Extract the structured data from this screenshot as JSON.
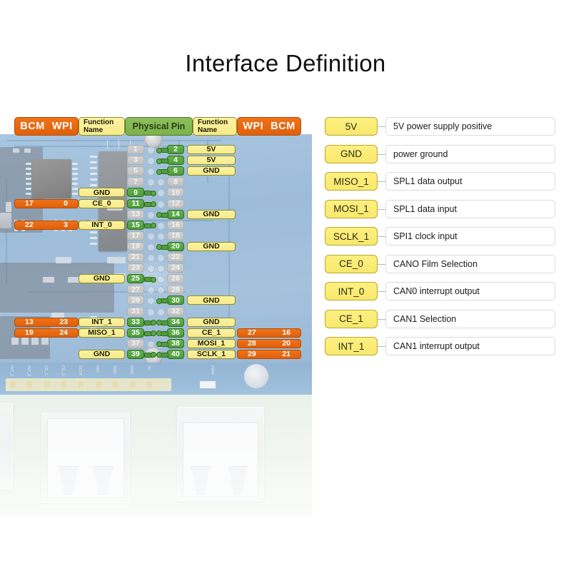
{
  "title": "Interface Definition",
  "header": {
    "left_bcm_wpi": [
      "BCM",
      "WPI"
    ],
    "left_function_name": [
      "Function",
      "Name"
    ],
    "physical_pin": "Physical Pin",
    "right_function_name": [
      "Function",
      "Name"
    ],
    "right_wpi_bcm": [
      "WPI",
      "BCM"
    ]
  },
  "pin_rows": [
    {
      "left_bcm": "",
      "left_wpi": "",
      "left_func": "",
      "pin_l": "1",
      "pin_l_active": false,
      "pin_r": "2",
      "pin_r_active": true,
      "right_func": "5V",
      "right_wpi": "",
      "right_bcm": ""
    },
    {
      "left_bcm": "",
      "left_wpi": "",
      "left_func": "",
      "pin_l": "3",
      "pin_l_active": false,
      "pin_r": "4",
      "pin_r_active": true,
      "right_func": "5V",
      "right_wpi": "",
      "right_bcm": ""
    },
    {
      "left_bcm": "",
      "left_wpi": "",
      "left_func": "",
      "pin_l": "5",
      "pin_l_active": false,
      "pin_r": "6",
      "pin_r_active": true,
      "right_func": "GND",
      "right_wpi": "",
      "right_bcm": ""
    },
    {
      "left_bcm": "",
      "left_wpi": "",
      "left_func": "",
      "pin_l": "7",
      "pin_l_active": false,
      "pin_r": "8",
      "pin_r_active": false,
      "right_func": "",
      "right_wpi": "",
      "right_bcm": ""
    },
    {
      "left_bcm": "",
      "left_wpi": "",
      "left_func": "GND",
      "pin_l": "9",
      "pin_l_active": true,
      "pin_r": "10",
      "pin_r_active": false,
      "right_func": "",
      "right_wpi": "",
      "right_bcm": ""
    },
    {
      "left_bcm": "17",
      "left_wpi": "0",
      "left_func": "CE_0",
      "pin_l": "11",
      "pin_l_active": true,
      "pin_r": "12",
      "pin_r_active": false,
      "right_func": "",
      "right_wpi": "",
      "right_bcm": ""
    },
    {
      "left_bcm": "",
      "left_wpi": "",
      "left_func": "",
      "pin_l": "13",
      "pin_l_active": false,
      "pin_r": "14",
      "pin_r_active": true,
      "right_func": "GND",
      "right_wpi": "",
      "right_bcm": ""
    },
    {
      "left_bcm": "22",
      "left_wpi": "3",
      "left_func": "INT_0",
      "pin_l": "15",
      "pin_l_active": true,
      "pin_r": "16",
      "pin_r_active": false,
      "right_func": "",
      "right_wpi": "",
      "right_bcm": ""
    },
    {
      "left_bcm": "",
      "left_wpi": "",
      "left_func": "",
      "pin_l": "17",
      "pin_l_active": false,
      "pin_r": "18",
      "pin_r_active": false,
      "right_func": "",
      "right_wpi": "",
      "right_bcm": ""
    },
    {
      "left_bcm": "",
      "left_wpi": "",
      "left_func": "",
      "pin_l": "19",
      "pin_l_active": false,
      "pin_r": "20",
      "pin_r_active": true,
      "right_func": "GND",
      "right_wpi": "",
      "right_bcm": ""
    },
    {
      "left_bcm": "",
      "left_wpi": "",
      "left_func": "",
      "pin_l": "21",
      "pin_l_active": false,
      "pin_r": "22",
      "pin_r_active": false,
      "right_func": "",
      "right_wpi": "",
      "right_bcm": ""
    },
    {
      "left_bcm": "",
      "left_wpi": "",
      "left_func": "",
      "pin_l": "23",
      "pin_l_active": false,
      "pin_r": "24",
      "pin_r_active": false,
      "right_func": "",
      "right_wpi": "",
      "right_bcm": ""
    },
    {
      "left_bcm": "",
      "left_wpi": "",
      "left_func": "GND",
      "pin_l": "25",
      "pin_l_active": true,
      "pin_r": "26",
      "pin_r_active": false,
      "right_func": "",
      "right_wpi": "",
      "right_bcm": ""
    },
    {
      "left_bcm": "",
      "left_wpi": "",
      "left_func": "",
      "pin_l": "27",
      "pin_l_active": false,
      "pin_r": "28",
      "pin_r_active": false,
      "right_func": "",
      "right_wpi": "",
      "right_bcm": ""
    },
    {
      "left_bcm": "",
      "left_wpi": "",
      "left_func": "",
      "pin_l": "29",
      "pin_l_active": false,
      "pin_r": "30",
      "pin_r_active": true,
      "right_func": "GND",
      "right_wpi": "",
      "right_bcm": ""
    },
    {
      "left_bcm": "",
      "left_wpi": "",
      "left_func": "",
      "pin_l": "31",
      "pin_l_active": false,
      "pin_r": "32",
      "pin_r_active": false,
      "right_func": "",
      "right_wpi": "",
      "right_bcm": ""
    },
    {
      "left_bcm": "13",
      "left_wpi": "23",
      "left_func": "INT_1",
      "pin_l": "33",
      "pin_l_active": true,
      "pin_r": "34",
      "pin_r_active": true,
      "right_func": "GND",
      "right_wpi": "",
      "right_bcm": ""
    },
    {
      "left_bcm": "19",
      "left_wpi": "24",
      "left_func": "MISO_1",
      "pin_l": "35",
      "pin_l_active": true,
      "pin_r": "36",
      "pin_r_active": true,
      "right_func": "CE_1",
      "right_wpi": "27",
      "right_bcm": "16"
    },
    {
      "left_bcm": "",
      "left_wpi": "",
      "left_func": "",
      "pin_l": "37",
      "pin_l_active": false,
      "pin_r": "38",
      "pin_r_active": true,
      "right_func": "MOSI_1",
      "right_wpi": "28",
      "right_bcm": "20"
    },
    {
      "left_bcm": "",
      "left_wpi": "",
      "left_func": "GND",
      "pin_l": "39",
      "pin_l_active": true,
      "pin_r": "40",
      "pin_r_active": true,
      "right_func": "SCLK_1",
      "right_wpi": "29",
      "right_bcm": "21"
    }
  ],
  "legend": [
    {
      "signal": "5V",
      "description": "5V power supply positive"
    },
    {
      "signal": "GND",
      "description": "power ground"
    },
    {
      "signal": "MISO_1",
      "description": "SPL1 data output"
    },
    {
      "signal": "MOSI_1",
      "description": "SPL1 data input"
    },
    {
      "signal": "SCLK_1",
      "description": "SPI1 clock input"
    },
    {
      "signal": "CE_0",
      "description": "CANO Film Selection"
    },
    {
      "signal": "INT_0",
      "description": "CAN0 interrupt output"
    },
    {
      "signal": "CE_1",
      "description": "CAN1 Selection"
    },
    {
      "signal": "INT_1",
      "description": "CAN1 interrupt output"
    }
  ],
  "board_photo": {
    "lower_header_labels": [
      "INT_1",
      "INT_0",
      "CE_1",
      "CE_0",
      "SCLK",
      "SDI",
      "SDO",
      "GND",
      "3V",
      "PWR"
    ]
  },
  "colors": {
    "orange": "#ef7218",
    "yellow": "#fdf3a0",
    "green": "#4f9c3b",
    "gray": "#c8c8c8",
    "legend_badge": "#fdf07f"
  }
}
